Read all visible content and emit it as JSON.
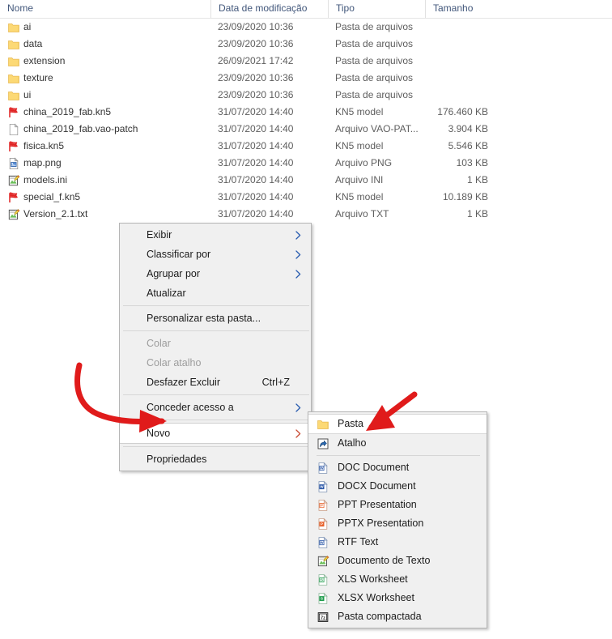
{
  "columns": [
    {
      "label": "Nome"
    },
    {
      "label": "Data de modificação"
    },
    {
      "label": "Tipo"
    },
    {
      "label": "Tamanho"
    }
  ],
  "files": [
    {
      "icon": "folder-icon",
      "name": "ai",
      "date": "23/09/2020 10:36",
      "type": "Pasta de arquivos",
      "size": ""
    },
    {
      "icon": "folder-icon",
      "name": "data",
      "date": "23/09/2020 10:36",
      "type": "Pasta de arquivos",
      "size": ""
    },
    {
      "icon": "folder-icon",
      "name": "extension",
      "date": "26/09/2021 17:42",
      "type": "Pasta de arquivos",
      "size": ""
    },
    {
      "icon": "folder-icon",
      "name": "texture",
      "date": "23/09/2020 10:36",
      "type": "Pasta de arquivos",
      "size": ""
    },
    {
      "icon": "folder-icon",
      "name": "ui",
      "date": "23/09/2020 10:36",
      "type": "Pasta de arquivos",
      "size": ""
    },
    {
      "icon": "kn5-model-icon",
      "name": "china_2019_fab.kn5",
      "date": "31/07/2020 14:40",
      "type": "KN5 model",
      "size": "176.460 KB"
    },
    {
      "icon": "blank-file-icon",
      "name": "china_2019_fab.vao-patch",
      "date": "31/07/2020 14:40",
      "type": "Arquivo VAO-PAT...",
      "size": "3.904 KB"
    },
    {
      "icon": "kn5-model-icon",
      "name": "fisica.kn5",
      "date": "31/07/2020 14:40",
      "type": "KN5 model",
      "size": "5.546 KB"
    },
    {
      "icon": "png-image-icon",
      "name": "map.png",
      "date": "31/07/2020 14:40",
      "type": "Arquivo PNG",
      "size": "103 KB"
    },
    {
      "icon": "text-editor-icon",
      "name": "models.ini",
      "date": "31/07/2020 14:40",
      "type": "Arquivo INI",
      "size": "1 KB"
    },
    {
      "icon": "kn5-model-icon",
      "name": "special_f.kn5",
      "date": "31/07/2020 14:40",
      "type": "KN5 model",
      "size": "10.189 KB"
    },
    {
      "icon": "text-editor-icon",
      "name": "Version_2.1.txt",
      "date": "31/07/2020 14:40",
      "type": "Arquivo TXT",
      "size": "1 KB"
    }
  ],
  "context_menu": {
    "items": [
      {
        "kind": "item",
        "label": "Exibir",
        "submenu": true,
        "disabled": false,
        "highlighted": false,
        "accel": ""
      },
      {
        "kind": "item",
        "label": "Classificar por",
        "submenu": true,
        "disabled": false,
        "highlighted": false,
        "accel": ""
      },
      {
        "kind": "item",
        "label": "Agrupar por",
        "submenu": true,
        "disabled": false,
        "highlighted": false,
        "accel": ""
      },
      {
        "kind": "item",
        "label": "Atualizar",
        "submenu": false,
        "disabled": false,
        "highlighted": false,
        "accel": ""
      },
      {
        "kind": "separator",
        "label": ""
      },
      {
        "kind": "item",
        "label": "Personalizar esta pasta...",
        "submenu": false,
        "disabled": false,
        "highlighted": false,
        "accel": ""
      },
      {
        "kind": "separator",
        "label": ""
      },
      {
        "kind": "item",
        "label": "Colar",
        "submenu": false,
        "disabled": true,
        "highlighted": false,
        "accel": ""
      },
      {
        "kind": "item",
        "label": "Colar atalho",
        "submenu": false,
        "disabled": true,
        "highlighted": false,
        "accel": ""
      },
      {
        "kind": "item",
        "label": "Desfazer Excluir",
        "submenu": false,
        "disabled": false,
        "highlighted": false,
        "accel": "Ctrl+Z"
      },
      {
        "kind": "separator",
        "label": ""
      },
      {
        "kind": "item",
        "label": "Conceder acesso a",
        "submenu": true,
        "disabled": false,
        "highlighted": false,
        "accel": ""
      },
      {
        "kind": "separator",
        "label": ""
      },
      {
        "kind": "item",
        "label": "Novo",
        "submenu": true,
        "disabled": false,
        "highlighted": true,
        "accel": ""
      },
      {
        "kind": "separator",
        "label": ""
      },
      {
        "kind": "item",
        "label": "Propriedades",
        "submenu": false,
        "disabled": false,
        "highlighted": false,
        "accel": ""
      }
    ]
  },
  "submenu": {
    "items": [
      {
        "kind": "item",
        "icon": "folder-icon",
        "label": "Pasta",
        "highlighted": true
      },
      {
        "kind": "item",
        "icon": "shortcut-icon",
        "label": "Atalho",
        "highlighted": false
      },
      {
        "kind": "separator",
        "icon": "",
        "label": ""
      },
      {
        "kind": "item",
        "icon": "word-doc-icon",
        "label": "DOC Document",
        "highlighted": false
      },
      {
        "kind": "item",
        "icon": "word-docx-icon",
        "label": "DOCX Document",
        "highlighted": false
      },
      {
        "kind": "item",
        "icon": "powerpoint-ppt-icon",
        "label": "PPT Presentation",
        "highlighted": false
      },
      {
        "kind": "item",
        "icon": "powerpoint-pptx-icon",
        "label": "PPTX Presentation",
        "highlighted": false
      },
      {
        "kind": "item",
        "icon": "rtf-text-icon",
        "label": "RTF Text",
        "highlighted": false
      },
      {
        "kind": "item",
        "icon": "text-editor-icon",
        "label": "Documento de Texto",
        "highlighted": false
      },
      {
        "kind": "item",
        "icon": "excel-xls-icon",
        "label": "XLS Worksheet",
        "highlighted": false
      },
      {
        "kind": "item",
        "icon": "excel-xlsx-icon",
        "label": "XLSX Worksheet",
        "highlighted": false
      },
      {
        "kind": "item",
        "icon": "zip-folder-icon",
        "label": "Pasta compactada",
        "highlighted": false
      }
    ]
  },
  "annotations": {
    "arrow_color": "#e01b1b",
    "arrows": [
      {
        "name": "arrow-to-novo",
        "description": "curved red arrow pointing right at the Novo menu item"
      },
      {
        "name": "arrow-to-pasta",
        "description": "diagonal red arrow pointing down-left at the Pasta submenu item"
      }
    ]
  }
}
